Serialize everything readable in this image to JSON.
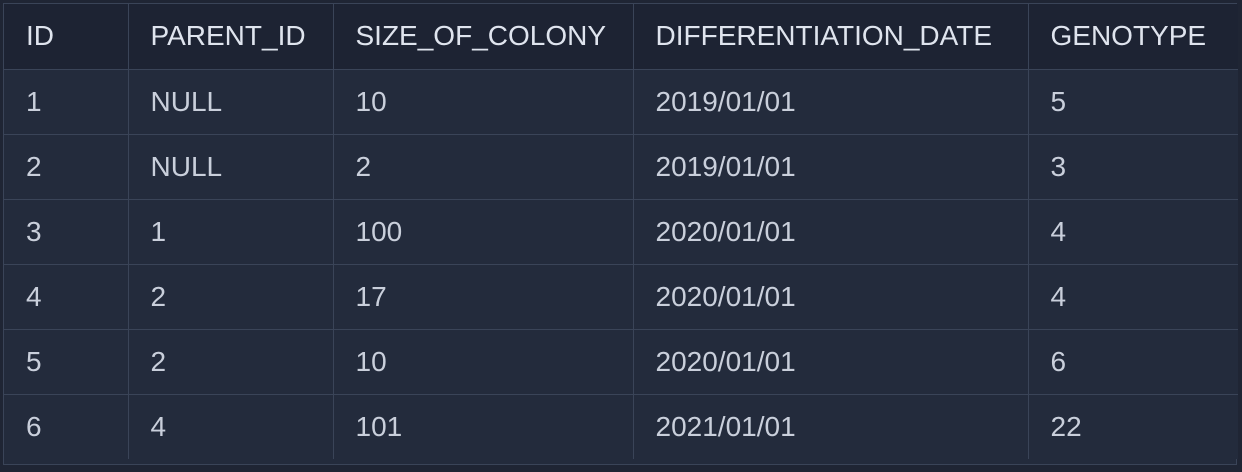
{
  "table": {
    "columns": [
      "ID",
      "PARENT_ID",
      "SIZE_OF_COLONY",
      "DIFFERENTIATION_DATE",
      "GENOTYPE"
    ],
    "rows": [
      [
        "1",
        "NULL",
        "10",
        "2019/01/01",
        "5"
      ],
      [
        "2",
        "NULL",
        "2",
        "2019/01/01",
        "3"
      ],
      [
        "3",
        "1",
        "100",
        "2020/01/01",
        "4"
      ],
      [
        "4",
        "2",
        "17",
        "2020/01/01",
        "4"
      ],
      [
        "5",
        "2",
        "10",
        "2020/01/01",
        "6"
      ],
      [
        "6",
        "4",
        "101",
        "2021/01/01",
        "22"
      ]
    ]
  },
  "colors": {
    "background": "#1f2534",
    "header_background": "#1d2333",
    "row_background": "#232b3c",
    "border": "#3a4458",
    "text": "#c9cfdb"
  }
}
